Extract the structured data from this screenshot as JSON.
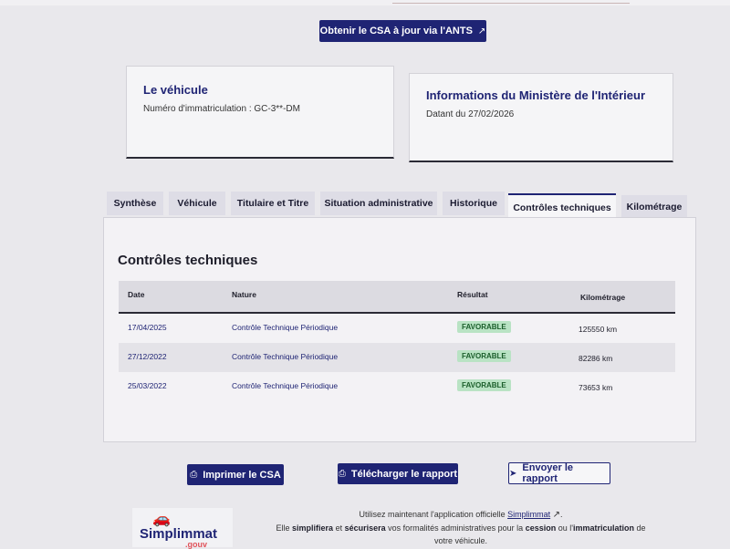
{
  "header": {
    "ants_button_label": "Obtenir le CSA à jour via l'ANTS"
  },
  "vehicle_card": {
    "title": "Le véhicule",
    "registration": "Numéro d'immatriculation : GC-3**-DM"
  },
  "ministry_card": {
    "title": "Informations du Ministère de l'Intérieur",
    "date_line": "Datant du 27/02/2026"
  },
  "tabs": [
    {
      "label": "Synthèse"
    },
    {
      "label": "Véhicule"
    },
    {
      "label": "Titulaire et Titre"
    },
    {
      "label": "Situation administrative"
    },
    {
      "label": "Historique"
    },
    {
      "label": "Contrôles techniques"
    },
    {
      "label": "Kilométrage"
    }
  ],
  "active_tab": "Contrôles techniques",
  "section": {
    "title": "Contrôles techniques",
    "columns": [
      "Date",
      "Nature",
      "Résultat",
      "Kilométrage"
    ],
    "rows": [
      {
        "date": "17/04/2025",
        "nature": "Contrôle Technique Périodique",
        "result": "FAVORABLE",
        "km": "125550 km"
      },
      {
        "date": "27/12/2022",
        "nature": "Contrôle Technique Périodique",
        "result": "FAVORABLE",
        "km": "82286 km"
      },
      {
        "date": "25/03/2022",
        "nature": "Contrôle Technique Périodique",
        "result": "FAVORABLE",
        "km": "73653 km"
      }
    ]
  },
  "actions": {
    "print_label": "Imprimer le CSA",
    "download_label": "Télécharger le rapport",
    "send_label": "Envoyer le rapport"
  },
  "promo": {
    "logo_text": "Simplimmat",
    "logo_sub": ".gouv",
    "line1_prefix": "Utilisez maintenant l'application officielle ",
    "app_link": "Simplimmat",
    "line1_suffix": ".",
    "line2_a": "Elle ",
    "line2_b": "simplifiera",
    "line2_c": " et ",
    "line2_d": "sécurisera",
    "line2_e": " vos formalités administratives pour la ",
    "line2_f": "cession",
    "line2_g": " ou l'",
    "line2_h": "immatriculation",
    "line2_i": " de",
    "line3": "votre véhicule."
  },
  "colors": {
    "primary": "#1f2474",
    "badge_bg": "#b9e3c4",
    "badge_text": "#1b5e2b",
    "logo_accent": "#e0525a"
  }
}
